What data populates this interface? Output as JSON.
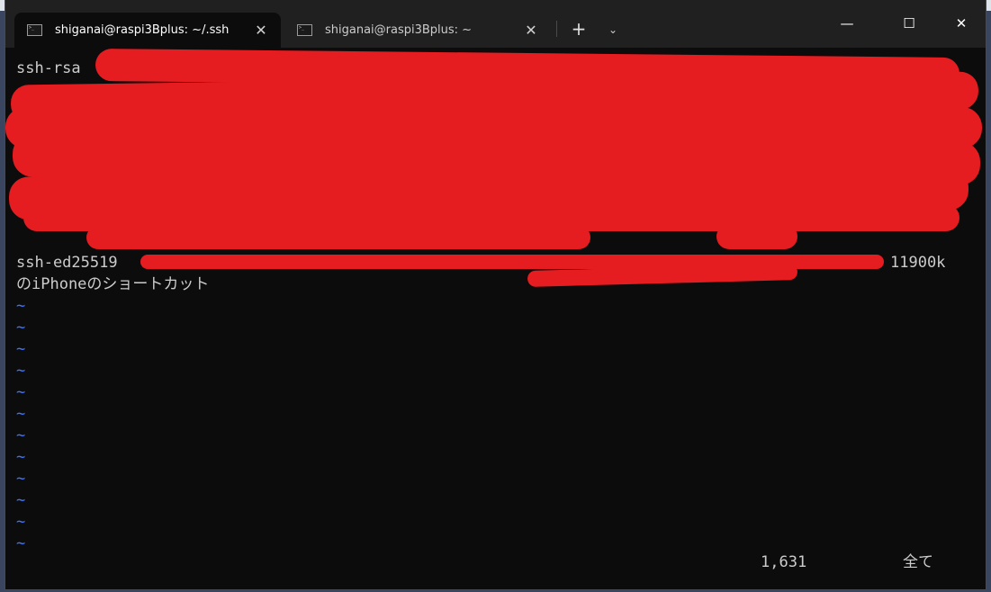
{
  "tabs": [
    {
      "title": "shiganai@raspi3Bplus: ~/.ssh",
      "active": true,
      "icon": "terminal-icon",
      "close": "✕"
    },
    {
      "title": "shiganai@raspi3Bplus: ~",
      "active": false,
      "icon": "terminal-icon",
      "close": "✕"
    }
  ],
  "toolbar": {
    "new_tab": "+",
    "dropdown": "⌄"
  },
  "window_controls": {
    "minimize": "—",
    "maximize": "☐",
    "close": "✕"
  },
  "terminal": {
    "lines": {
      "line1": "ssh-rsa",
      "line2": "ssh-ed25519",
      "line2_suffix": "11900k",
      "line3": "のiPhoneのショートカット"
    },
    "tilde": "~",
    "status_position": "1,631",
    "status_scope": "全て"
  },
  "colors": {
    "accent_tilde": "#3b78ff",
    "redaction": "#e51c20",
    "terminal_bg": "#0c0c0c",
    "titlebar_bg": "#202020"
  }
}
